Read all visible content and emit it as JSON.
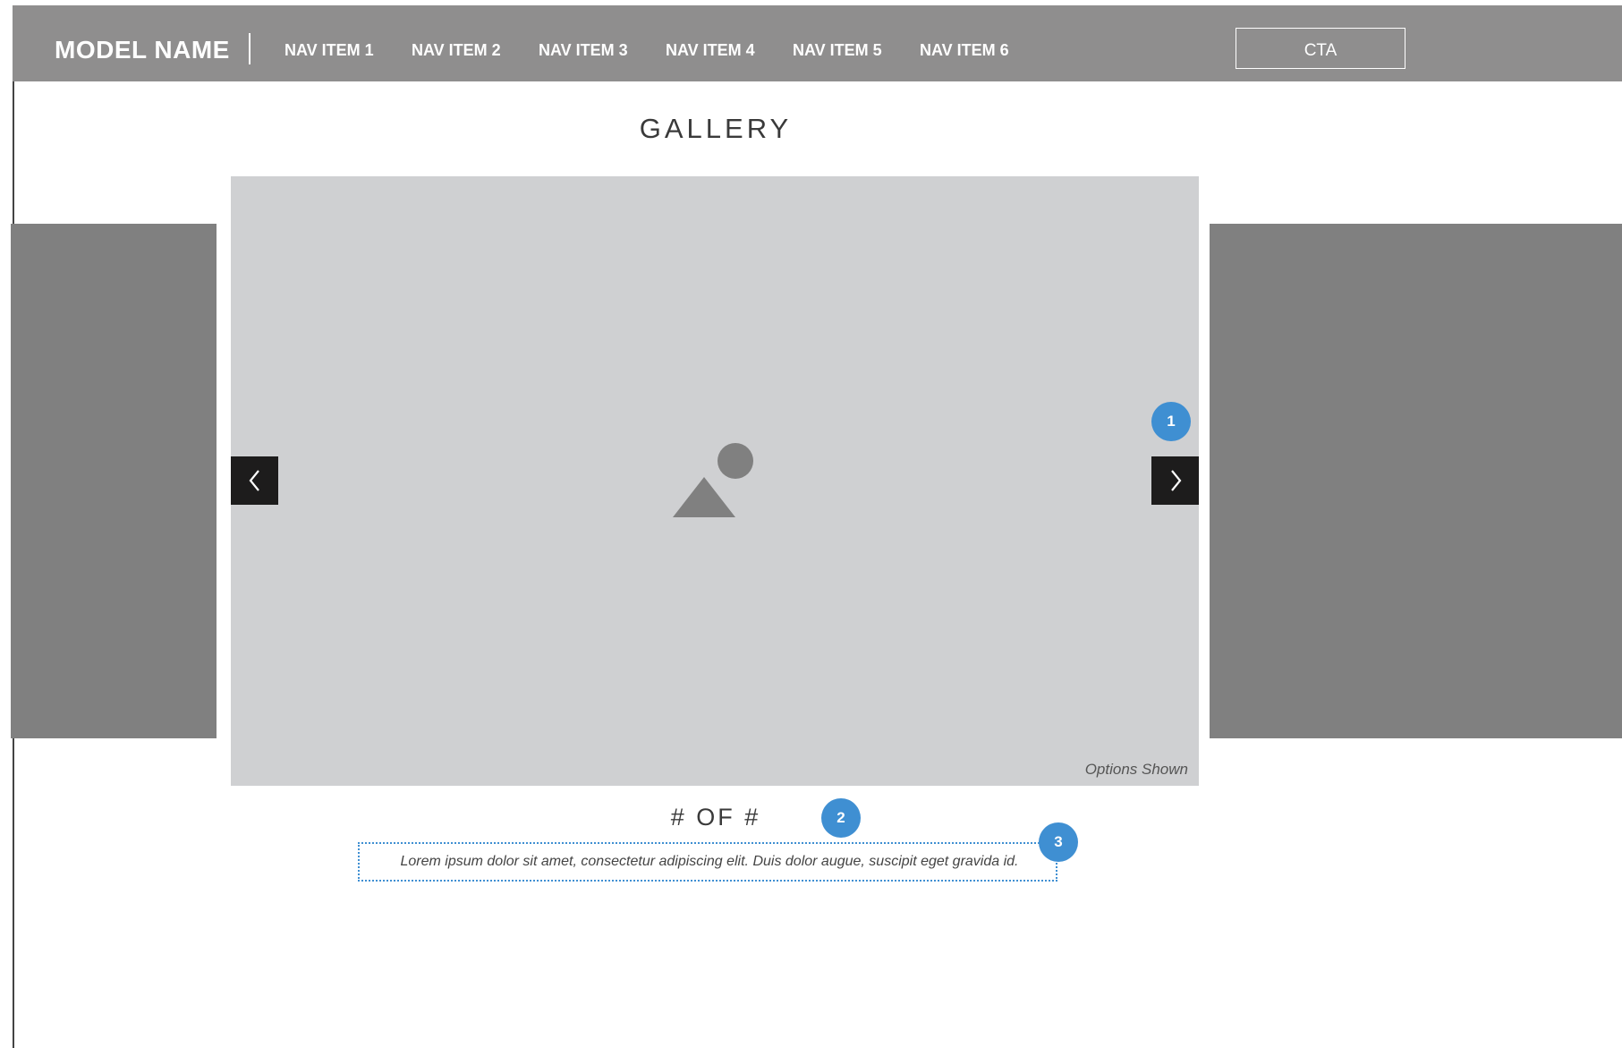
{
  "header": {
    "brand": "MODEL NAME",
    "nav": [
      "NAV ITEM 1",
      "NAV ITEM 2",
      "NAV ITEM 3",
      "NAV ITEM 4",
      "NAV ITEM 5",
      "NAV ITEM 6"
    ],
    "cta": "CTA"
  },
  "gallery": {
    "title": "GALLERY",
    "options_shown": "Options Shown",
    "counter": "# OF #",
    "caption": "Lorem ipsum dolor sit amet, consectetur adipiscing elit. Duis dolor augue, suscipit eget gravida id."
  },
  "annotations": [
    "1",
    "2",
    "3"
  ],
  "colors": {
    "header_bg": "#8f8e8e",
    "side_panel": "#808080",
    "image_bg": "#cfd0d2",
    "arrow_bg": "#1d1c1c",
    "marker": "#3f8fd2"
  }
}
